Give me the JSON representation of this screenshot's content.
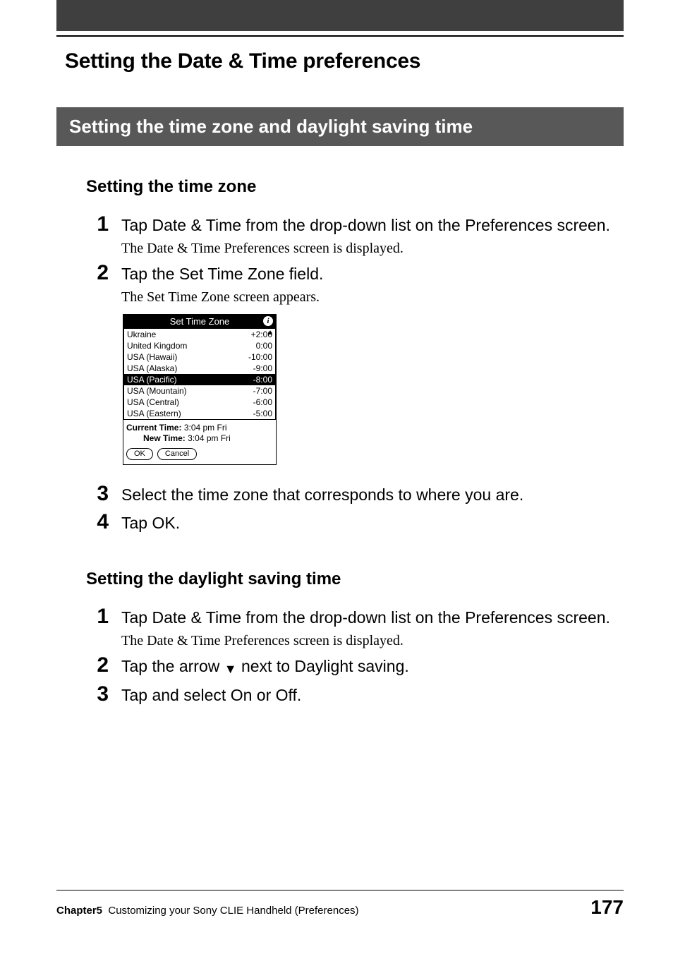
{
  "header": {
    "title": "Setting the Date & Time preferences"
  },
  "band": "Setting the time zone and daylight saving time",
  "section_tz": {
    "heading": "Setting the time zone",
    "steps": [
      {
        "num": "1",
        "bold": "Tap Date & Time from the drop-down list on the Preferences screen.",
        "sub": "The Date & Time Preferences screen is displayed."
      },
      {
        "num": "2",
        "bold": "Tap the Set Time Zone field.",
        "sub": "The Set Time Zone screen appears."
      },
      {
        "num": "3",
        "bold": "Select the time zone that corresponds to where you are."
      },
      {
        "num": "4",
        "bold": "Tap OK."
      }
    ]
  },
  "palm": {
    "title": "Set Time Zone",
    "info": "i",
    "arrow": "▲",
    "zones": [
      {
        "name": "Ukraine",
        "off": "+2:00"
      },
      {
        "name": "United Kingdom",
        "off": "0:00"
      },
      {
        "name": "USA (Hawaii)",
        "off": "-10:00"
      },
      {
        "name": "USA (Alaska)",
        "off": "-9:00"
      },
      {
        "name": "USA (Pacific)",
        "off": "-8:00",
        "selected": true
      },
      {
        "name": "USA (Mountain)",
        "off": "-7:00"
      },
      {
        "name": "USA (Central)",
        "off": "-6:00"
      },
      {
        "name": "USA (Eastern)",
        "off": "-5:00"
      }
    ],
    "current_label": "Current Time:",
    "current_val": "3:04 pm Fri",
    "new_label": "New Time:",
    "new_val": "3:04 pm Fri",
    "ok": "OK",
    "cancel": "Cancel"
  },
  "section_dst": {
    "heading": "Setting the daylight saving time",
    "steps": [
      {
        "num": "1",
        "bold": "Tap Date & Time from the drop-down list on the Preferences screen.",
        "sub": "The Date & Time Preferences screen is displayed."
      },
      {
        "num": "2",
        "bold_pre": "Tap the arrow ",
        "arrow": "▼",
        "bold_post": " next to Daylight saving."
      },
      {
        "num": "3",
        "bold": "Tap and select On or Off."
      }
    ]
  },
  "footer": {
    "chapter_label": "Chapter5",
    "chapter_text": "Customizing your Sony CLIE Handheld (Preferences)",
    "page": "177"
  }
}
